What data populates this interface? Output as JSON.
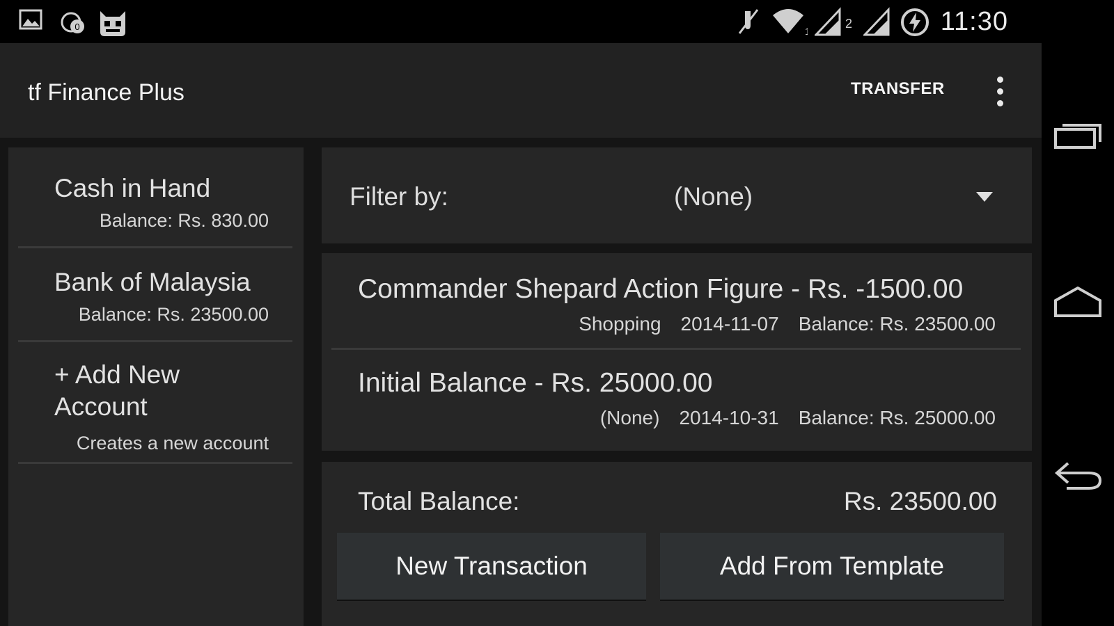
{
  "status_bar": {
    "time": "11:30",
    "left_icons": [
      "image-icon",
      "sync-badge-icon",
      "cyanogen-mascot-icon"
    ],
    "right_icons": [
      "mute-icon",
      "wifi-icon",
      "signal-sim1-icon",
      "signal-sim2-icon",
      "battery-charging-icon"
    ],
    "wifi_badge": "1",
    "sim2_badge": "2"
  },
  "action_bar": {
    "title": "tf Finance Plus",
    "transfer_label": "TRANSFER"
  },
  "accounts": [
    {
      "name": "Cash in Hand",
      "balance": "Balance: Rs. 830.00"
    },
    {
      "name": "Bank of Malaysia",
      "balance": "Balance: Rs. 23500.00"
    }
  ],
  "add_account": {
    "label_line1": "+ Add New",
    "label_line2": "Account",
    "subtitle": "Creates a new account"
  },
  "filter": {
    "label": "Filter by:",
    "value": "(None)"
  },
  "transactions": [
    {
      "title": "Commander Shepard Action Figure  -  Rs. -1500.00",
      "category": "Shopping",
      "date": "2014-11-07",
      "balance": "Balance: Rs. 23500.00"
    },
    {
      "title": "Initial Balance  -  Rs. 25000.00",
      "category": "(None)",
      "date": "2014-10-31",
      "balance": "Balance: Rs. 25000.00"
    }
  ],
  "totals": {
    "label": "Total Balance:",
    "value": "Rs. 23500.00"
  },
  "buttons": {
    "new_transaction": "New Transaction",
    "add_from_template": "Add From Template"
  },
  "nav_bar": {
    "icons": [
      "recent-apps-icon",
      "home-icon",
      "back-icon"
    ]
  },
  "colors": {
    "background": "#151515",
    "panel": "#262626",
    "action_bar": "#222222",
    "button": "#2e3133"
  }
}
